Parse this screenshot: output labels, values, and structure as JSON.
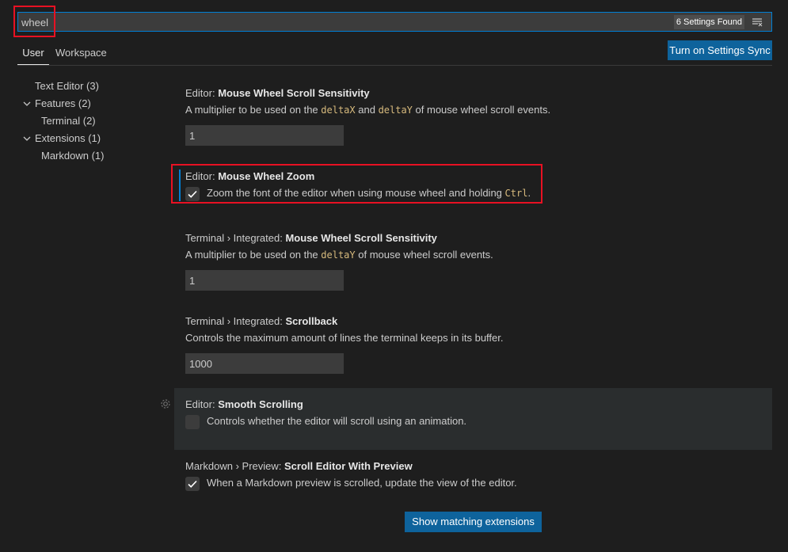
{
  "search": {
    "value": "wheel",
    "results_badge": "6 Settings Found"
  },
  "tabs": [
    {
      "label": "User"
    },
    {
      "label": "Workspace"
    }
  ],
  "sync_button": "Turn on Settings Sync",
  "toc": [
    {
      "label": "Text Editor (3)"
    },
    {
      "label": "Features (2)"
    },
    {
      "label": "Terminal (2)"
    },
    {
      "label": "Extensions (1)"
    },
    {
      "label": "Markdown (1)"
    }
  ],
  "settings": [
    {
      "category": "Editor: ",
      "name": "Mouse Wheel Scroll Sensitivity",
      "desc_pre": "A multiplier to be used on the ",
      "code1": "deltaX",
      "desc_mid": " and ",
      "code2": "deltaY",
      "desc_post": " of mouse wheel scroll events.",
      "value": "1"
    },
    {
      "category": "Editor: ",
      "name": "Mouse Wheel Zoom",
      "desc_pre": "Zoom the font of the editor when using mouse wheel and holding ",
      "code1": "Ctrl",
      "desc_post": ".",
      "checked": true
    },
    {
      "category": "Terminal › Integrated: ",
      "name": "Mouse Wheel Scroll Sensitivity",
      "desc_pre": "A multiplier to be used on the ",
      "code1": "deltaY",
      "desc_post": " of mouse wheel scroll events.",
      "value": "1"
    },
    {
      "category": "Terminal › Integrated: ",
      "name": "Scrollback",
      "desc": "Controls the maximum amount of lines the terminal keeps in its buffer.",
      "value": "1000"
    },
    {
      "category": "Editor: ",
      "name": "Smooth Scrolling",
      "desc": "Controls whether the editor will scroll using an animation.",
      "checked": false
    },
    {
      "category": "Markdown › Preview: ",
      "name": "Scroll Editor With Preview",
      "desc": "When a Markdown preview is scrolled, update the view of the editor.",
      "checked": true
    }
  ],
  "extensions_button": "Show matching extensions",
  "colors": {
    "accent": "#0e639c",
    "focus": "#007fd4",
    "highlight": "#e81123",
    "code": "#d7ba7d"
  }
}
